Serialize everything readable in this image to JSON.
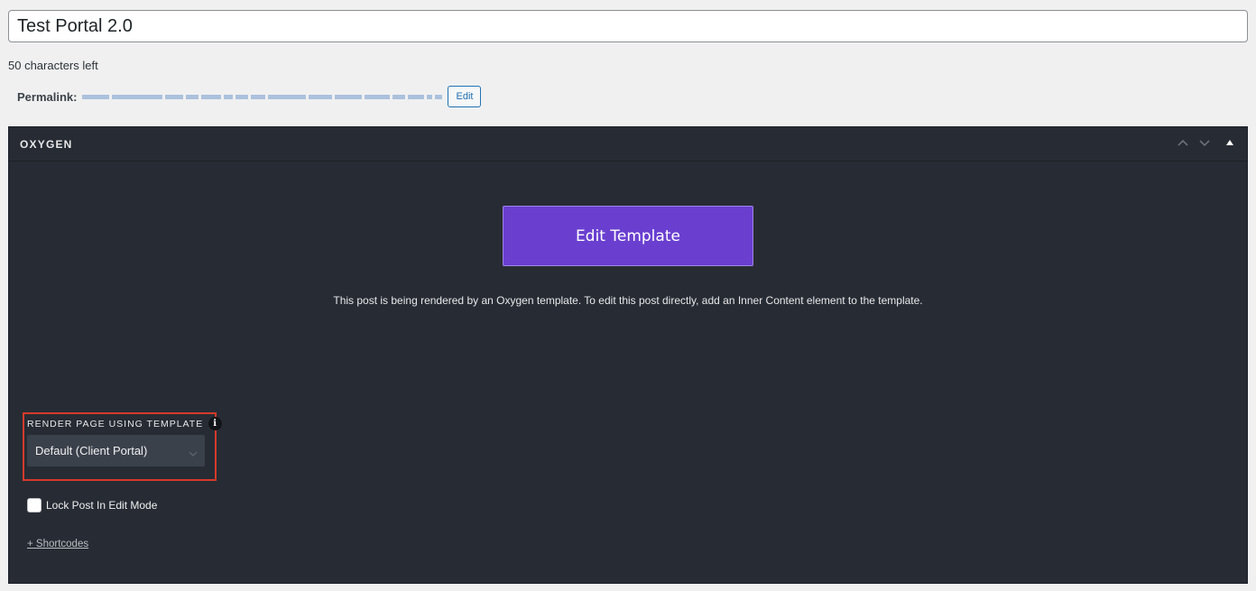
{
  "post": {
    "title_value": "Test Portal 2.0",
    "chars_left": "50 characters left",
    "permalink_label": "Permalink:",
    "permalink_edit_label": "Edit"
  },
  "oxygen": {
    "panel_title": "OXYGEN",
    "edit_template_label": "Edit Template",
    "render_note": "This post is being rendered by an Oxygen template. To edit this post directly, add an Inner Content element to the template.",
    "template_label": "RENDER PAGE USING TEMPLATE",
    "info_icon_glyph": "i",
    "template_selected": "Default (Client Portal)",
    "lock_label": "Lock Post In Edit Mode",
    "lock_checked": false,
    "shortcodes_label": "+ Shortcodes"
  },
  "icons": [
    "chevron-up-icon",
    "chevron-down-icon",
    "collapse-triangle-icon",
    "info-icon",
    "select-chevron-icon"
  ],
  "colors": {
    "panel_bg": "#272c34",
    "button_purple": "#6a3fd0",
    "highlight_red": "#d63a2a",
    "link_blue": "#2271b1"
  }
}
